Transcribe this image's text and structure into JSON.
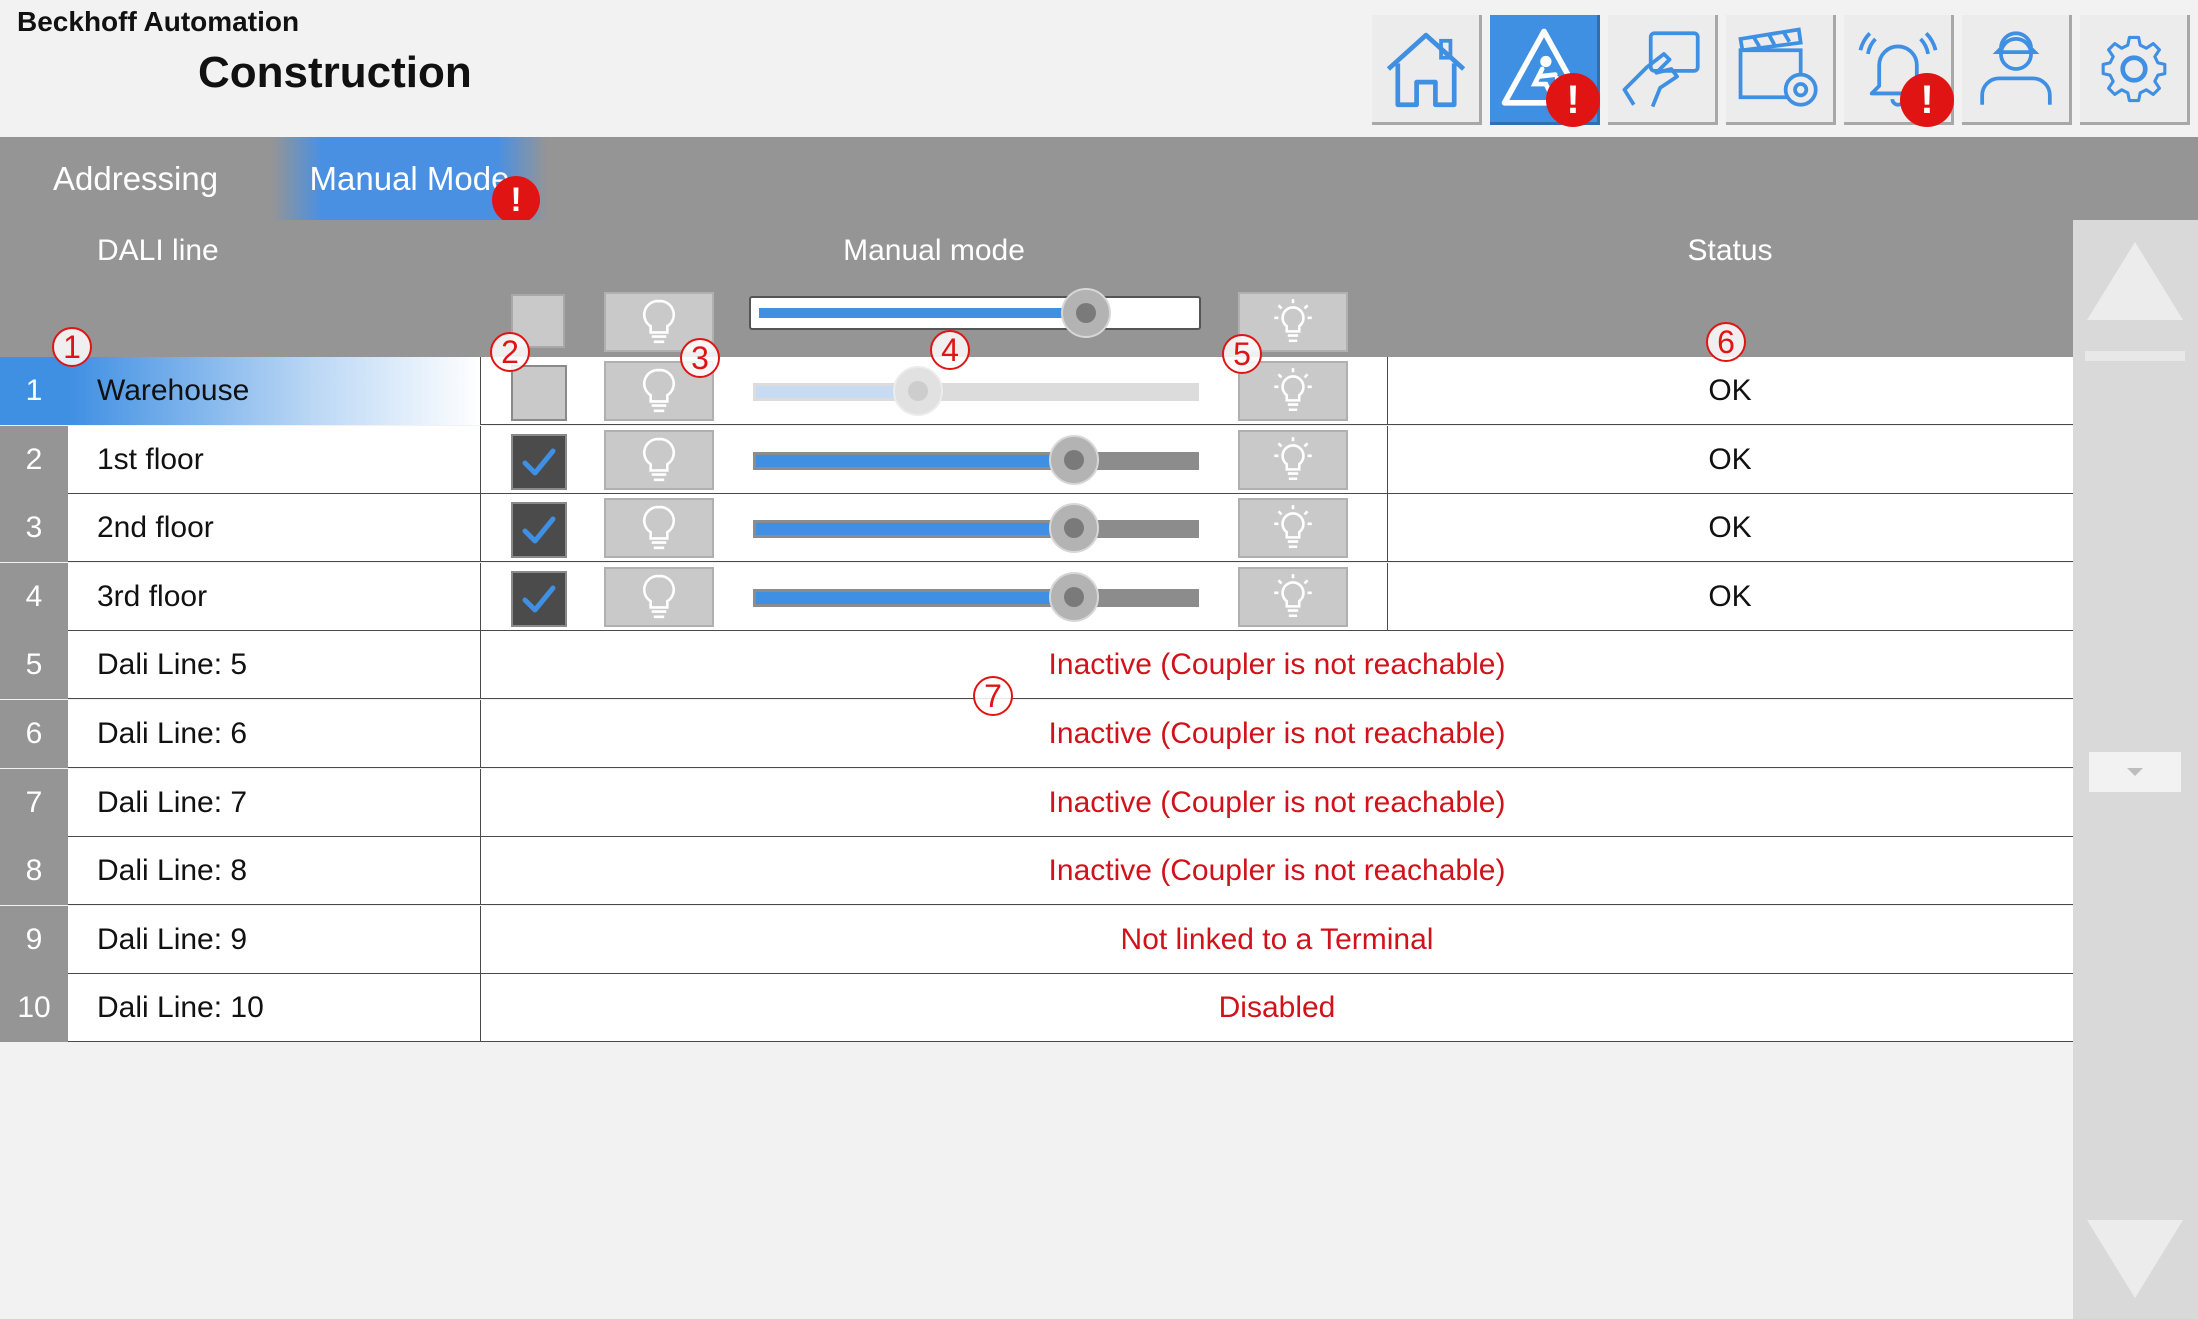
{
  "header": {
    "company": "Beckhoff Automation",
    "title": "Construction"
  },
  "nav": {
    "buttons": [
      {
        "icon": "home-icon",
        "active": false,
        "alert": false
      },
      {
        "icon": "construction-warning-icon",
        "active": true,
        "alert": true
      },
      {
        "icon": "hand-touch-icon",
        "active": false,
        "alert": false
      },
      {
        "icon": "scene-settings-icon",
        "active": false,
        "alert": false
      },
      {
        "icon": "alarm-bell-icon",
        "active": false,
        "alert": true
      },
      {
        "icon": "user-icon",
        "active": false,
        "alert": false
      },
      {
        "icon": "gear-icon",
        "active": false,
        "alert": false
      }
    ],
    "alert_symbol": "!"
  },
  "tabs": [
    {
      "label": "Addressing",
      "active": false
    },
    {
      "label": "Manual Mode",
      "active": true,
      "alert": true
    }
  ],
  "grid": {
    "headers": {
      "dali_line": "DALI line",
      "manual_mode": "Manual mode",
      "status": "Status"
    },
    "master_slider_fraction": 0.75,
    "rows": [
      {
        "num": "1",
        "name": "Warehouse",
        "selected": true,
        "checked": false,
        "slider_fraction": 0.37,
        "enabled": false,
        "status": "OK"
      },
      {
        "num": "2",
        "name": "1st floor",
        "selected": false,
        "checked": true,
        "slider_fraction": 0.72,
        "enabled": true,
        "status": "OK"
      },
      {
        "num": "3",
        "name": "2nd floor",
        "selected": false,
        "checked": true,
        "slider_fraction": 0.72,
        "enabled": true,
        "status": "OK"
      },
      {
        "num": "4",
        "name": "3rd floor",
        "selected": false,
        "checked": true,
        "slider_fraction": 0.72,
        "enabled": true,
        "status": "OK"
      },
      {
        "num": "5",
        "name": "Dali Line: 5",
        "message": "Inactive (Coupler is not reachable)"
      },
      {
        "num": "6",
        "name": "Dali Line: 6",
        "message": "Inactive (Coupler is not reachable)"
      },
      {
        "num": "7",
        "name": "Dali Line: 7",
        "message": "Inactive (Coupler is not reachable)"
      },
      {
        "num": "8",
        "name": "Dali Line: 8",
        "message": "Inactive (Coupler is not reachable)"
      },
      {
        "num": "9",
        "name": "Dali Line: 9",
        "message": "Not linked to a Terminal"
      },
      {
        "num": "10",
        "name": "Dali Line: 10",
        "message": "Disabled"
      }
    ]
  },
  "callouts": [
    "1",
    "2",
    "3",
    "4",
    "5",
    "6",
    "7"
  ],
  "colors": {
    "accent": "#3f8fe3",
    "alert": "#e11414",
    "error_text": "#d0121b",
    "header_gray": "#959595"
  }
}
